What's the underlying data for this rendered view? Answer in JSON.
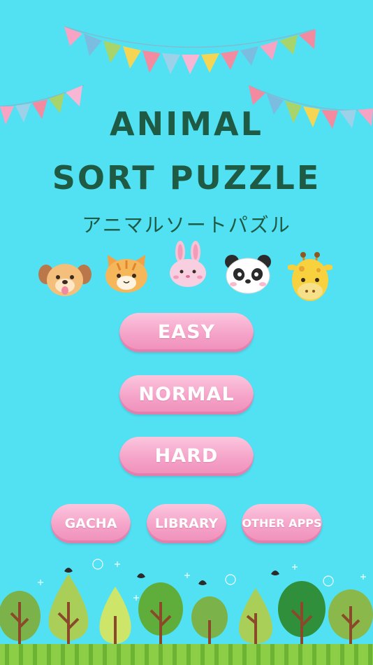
{
  "title": {
    "line1": "ANIMAL",
    "line2": "SORT PUZZLE",
    "subtitle": "アニマルソートパズル"
  },
  "animals": [
    {
      "icon": "dog-icon"
    },
    {
      "icon": "cat-icon"
    },
    {
      "icon": "rabbit-icon"
    },
    {
      "icon": "panda-icon"
    },
    {
      "icon": "giraffe-icon"
    }
  ],
  "menu": {
    "easy_label": "EASY",
    "normal_label": "NORMAL",
    "hard_label": "HARD",
    "gacha_label": "GACHA",
    "library_label": "LIBRARY",
    "other_apps_label": "OTHER APPS"
  },
  "colors": {
    "background": "#52e1f3",
    "title": "#1f5a44",
    "button": "#f5a3c8"
  }
}
